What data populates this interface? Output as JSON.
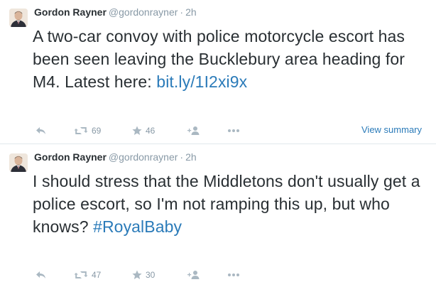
{
  "tweets": [
    {
      "name": "Gordon Rayner",
      "handle": "@gordonrayner",
      "separator": "·",
      "time": "2h",
      "text": "A two-car convoy with police motorcycle escort has been seen leaving the Bucklebury area heading for M4. Latest here: ",
      "link": "bit.ly/1I2xi9x",
      "retweets": "69",
      "favorites": "46",
      "summary_label": "View summary"
    },
    {
      "name": "Gordon Rayner",
      "handle": "@gordonrayner",
      "separator": "·",
      "time": "2h",
      "text": "I should stress that the Middletons don't usually get a police escort, so I'm not ramping this up, but who knows? ",
      "hashtag": "#RoyalBaby",
      "retweets": "47",
      "favorites": "30"
    }
  ],
  "icons": {
    "reply": "reply-icon",
    "retweet": "retweet-icon",
    "favorite": "star-icon",
    "follow": "follow-icon",
    "more": "more-icon"
  },
  "colors": {
    "link": "#2b7bb9",
    "muted": "#8899a6",
    "text": "#292f33"
  }
}
